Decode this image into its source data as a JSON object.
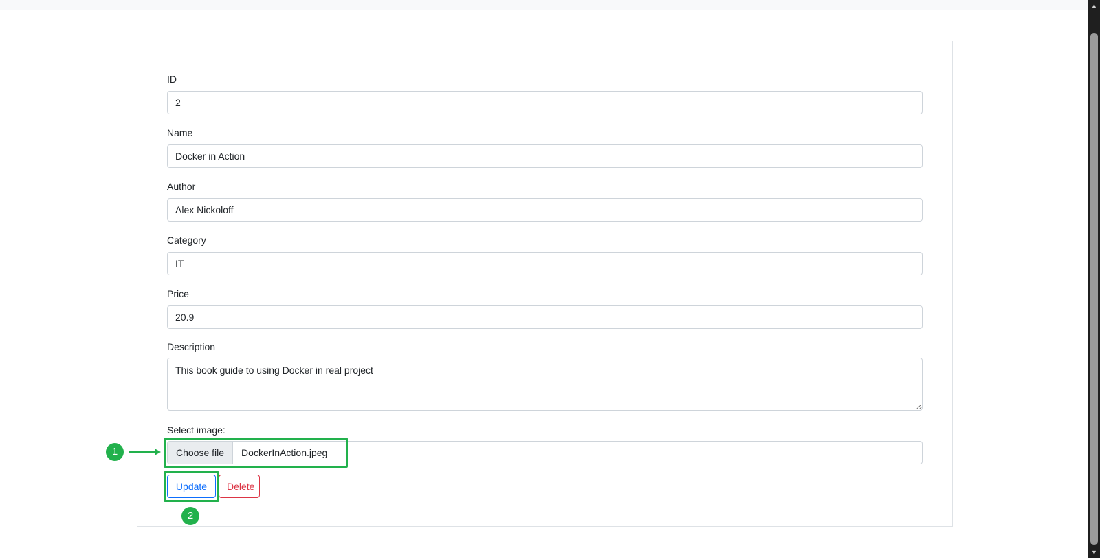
{
  "form": {
    "id": {
      "label": "ID",
      "value": "2"
    },
    "name": {
      "label": "Name",
      "value": "Docker in Action"
    },
    "author": {
      "label": "Author",
      "value": "Alex Nickoloff"
    },
    "category": {
      "label": "Category",
      "value": "IT"
    },
    "price": {
      "label": "Price",
      "value": "20.9"
    },
    "description": {
      "label": "Description",
      "value": "This book guide to using Docker in real project"
    },
    "image": {
      "label": "Select image:",
      "choose_label": "Choose file",
      "file_name": "DockerInAction.jpeg"
    },
    "update_label": "Update",
    "delete_label": "Delete"
  },
  "annotations": {
    "step1": "1",
    "step2": "2",
    "color": "#22b14c"
  },
  "colors": {
    "primary": "#0d6efd",
    "danger": "#dc3545",
    "border": "#ced4da"
  },
  "icons": {
    "arrow": "arrow-right-icon",
    "scroll_up": "scroll-up-icon",
    "scroll_down": "scroll-down-icon"
  }
}
